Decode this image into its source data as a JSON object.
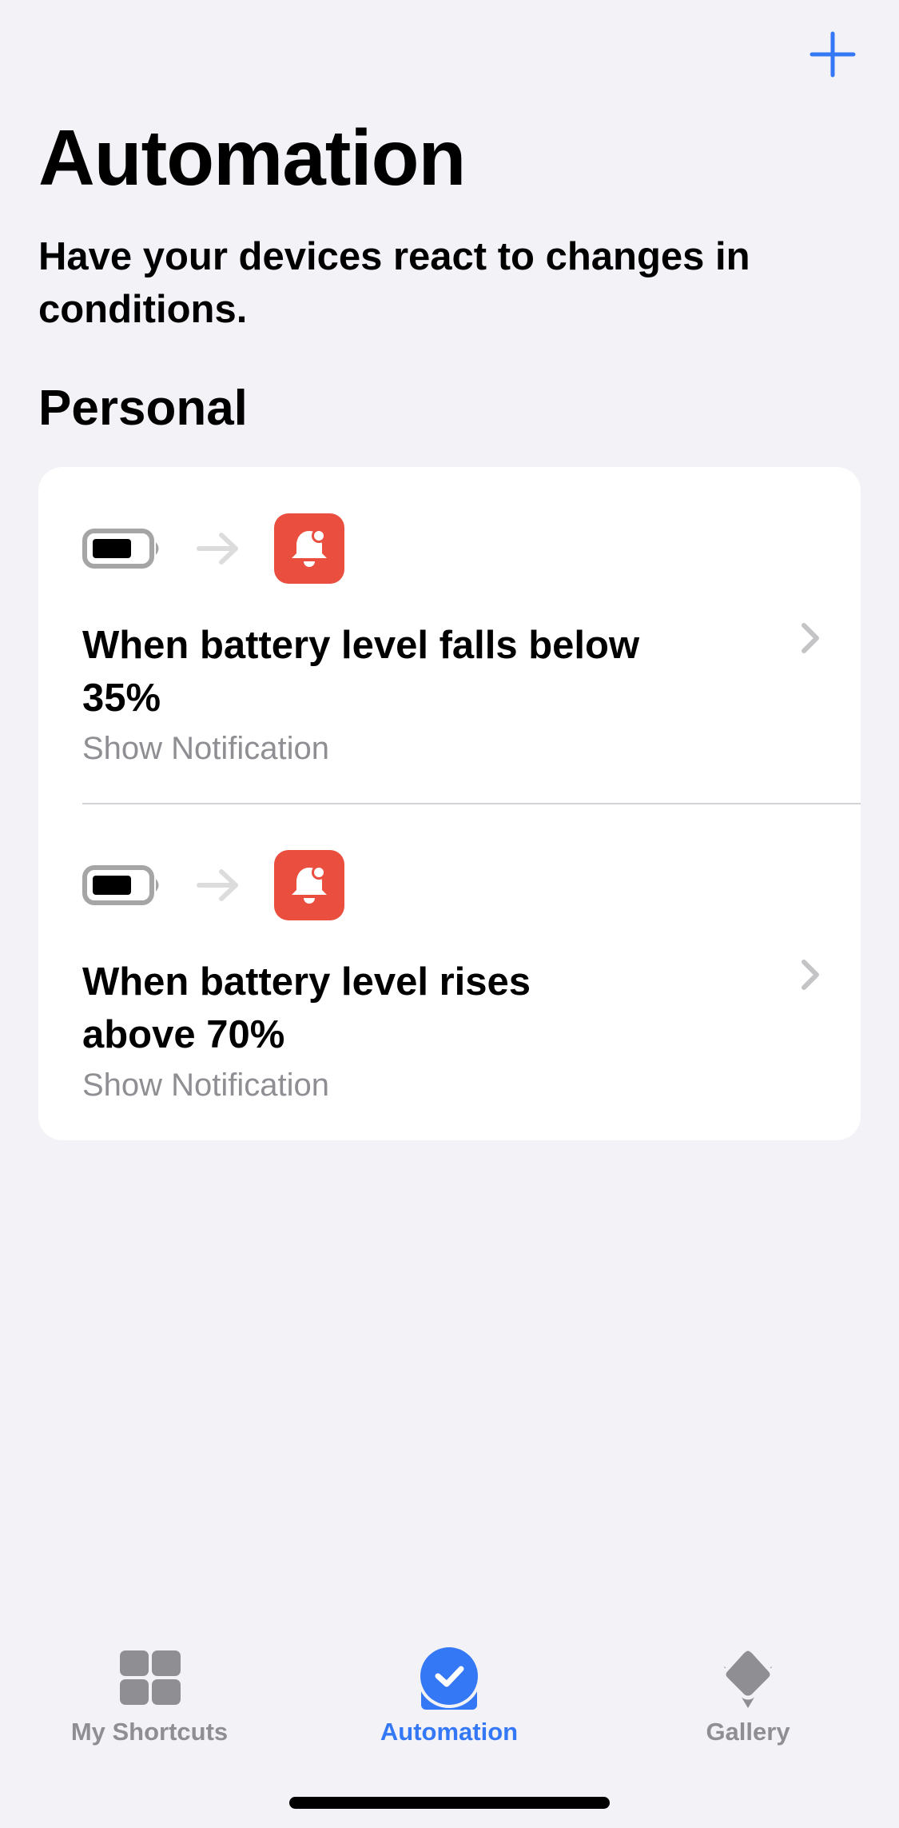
{
  "nav": {
    "add_button_icon": "plus-icon",
    "accent_color": "#3478f6"
  },
  "header": {
    "title": "Automation",
    "subtitle": "Have your devices react to changes in conditions."
  },
  "section": {
    "title": "Personal"
  },
  "automations": [
    {
      "trigger_icon": "battery-icon",
      "action_icon": "notification-bell-icon",
      "title": "When battery level falls below 35%",
      "action": "Show Notification"
    },
    {
      "trigger_icon": "battery-icon",
      "action_icon": "notification-bell-icon",
      "title": "When battery level rises above 70%",
      "action": "Show Notification"
    }
  ],
  "colors": {
    "notification_red": "#e94e3f",
    "inactive_gray": "#8e8e93",
    "background": "#f2f2f7"
  },
  "tabbar": {
    "tabs": [
      {
        "label": "My Shortcuts",
        "icon": "grid-icon",
        "active": false
      },
      {
        "label": "Automation",
        "icon": "clock-check-icon",
        "active": true
      },
      {
        "label": "Gallery",
        "icon": "layers-icon",
        "active": false
      }
    ]
  }
}
